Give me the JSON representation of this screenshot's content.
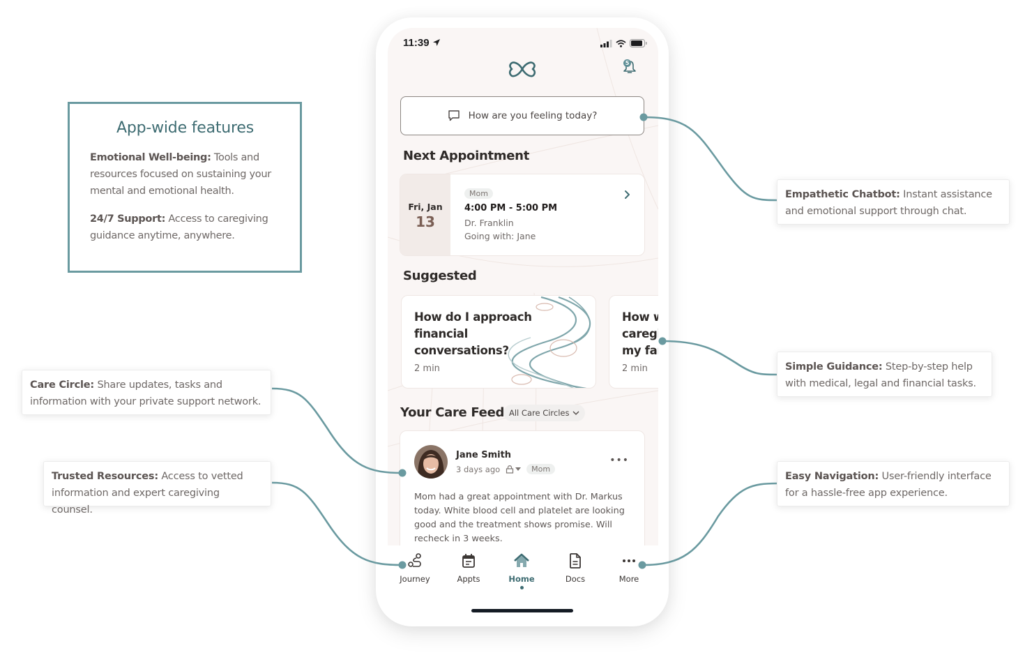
{
  "features_box": {
    "title": "App-wide features",
    "items": [
      {
        "label": "Emotional Well-being:",
        "text": " Tools and resources focused on sustaining your mental and emotional health."
      },
      {
        "label": "24/7 Support:",
        "text": " Access to caregiving guidance anytime, anywhere."
      }
    ]
  },
  "callouts": {
    "chatbot": {
      "label": "Empathetic Chatbot:",
      "text": " Instant assistance and emotional support through chat."
    },
    "guidance": {
      "label": "Simple Guidance:",
      "text": " Step-by-step help with medical, legal and financial tasks."
    },
    "navigation": {
      "label": "Easy Navigation:",
      "text": " User-friendly interface for a hassle-free app experience."
    },
    "care_circle": {
      "label": "Care Circle:",
      "text": " Share updates, tasks and information with your private support network."
    },
    "resources": {
      "label": "Trusted Resources:",
      "text": " Access to vetted information and expert caregiving counsel."
    }
  },
  "colors": {
    "accent": "#6a9aa0",
    "accent_dark": "#3e6c72",
    "screen_bg": "#faf6f5"
  },
  "status_bar": {
    "time": "11:39"
  },
  "header": {
    "notification_count": "5"
  },
  "chat": {
    "placeholder": "How are you feeling today?"
  },
  "next_appointment": {
    "section_title": "Next Appointment",
    "date_dow": "Fri, Jan",
    "date_day": "13",
    "tag": "Mom",
    "time": "4:00 PM - 5:00 PM",
    "doctor": "Dr. Franklin",
    "companion": "Going with: Jane"
  },
  "suggested": {
    "section_title": "Suggested",
    "cards": [
      {
        "title_lines": [
          "How do I approach",
          "financial",
          "conversations?"
        ],
        "duration": "2 min"
      },
      {
        "title_lines": [
          "How w",
          "caregi",
          "my far"
        ],
        "duration": "2 min"
      }
    ]
  },
  "care_feed": {
    "section_title": "Your Care Feed",
    "filter": "All Care Circles",
    "post": {
      "author": "Jane Smith",
      "time_ago": "3 days ago",
      "tag": "Mom",
      "body": "Mom had a great appointment with Dr. Markus today. White blood cell and platelet are looking good and the treatment shows promise. Will recheck in 3 weeks."
    }
  },
  "tabbar": {
    "tabs": [
      {
        "label": "Journey"
      },
      {
        "label": "Appts"
      },
      {
        "label": "Home",
        "active": true
      },
      {
        "label": "Docs"
      },
      {
        "label": "More"
      }
    ]
  }
}
